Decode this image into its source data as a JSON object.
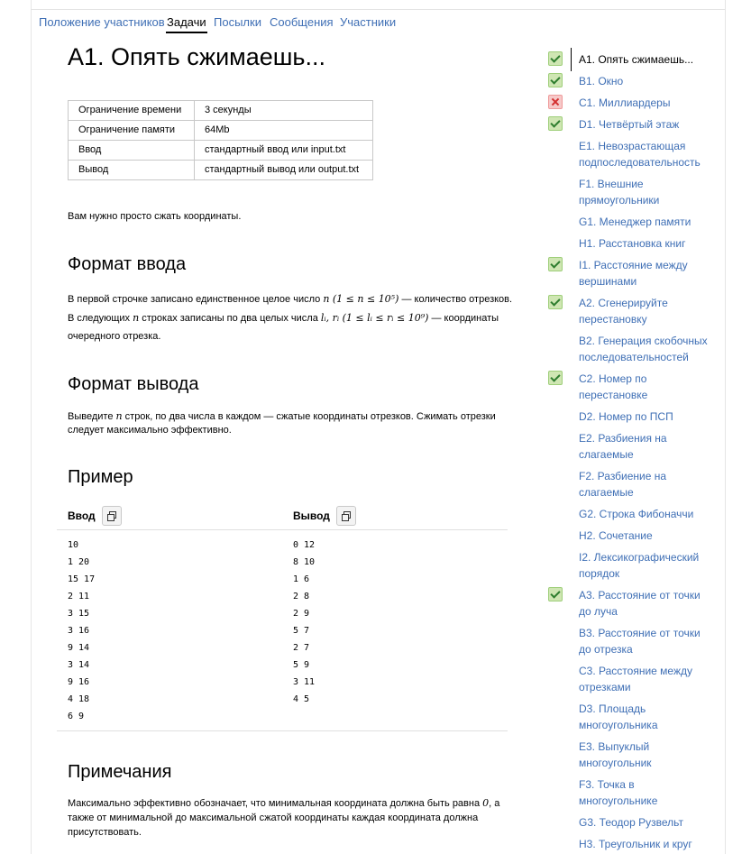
{
  "tabs": [
    "Положение участников",
    "Задачи",
    "Посылки",
    "Сообщения",
    "Участники"
  ],
  "problem": {
    "title": "А1. Опять сжимаешь...",
    "limits": [
      {
        "k": "Ограничение времени",
        "v": "3 секунды"
      },
      {
        "k": "Ограничение памяти",
        "v": "64Mb"
      },
      {
        "k": "Ввод",
        "v": "стандартный ввод или input.txt"
      },
      {
        "k": "Вывод",
        "v": "стандартный вывод или output.txt"
      }
    ],
    "statement": "Вам нужно просто сжать координаты.",
    "input_heading": "Формат ввода",
    "input_p1_a": "В первой строчке записано единственное целое число ",
    "input_p1_math": "n (1 ≤ n ≤ 10⁵)",
    "input_p1_b": " — количество отрезков.",
    "input_p2_a": "В следующих ",
    "input_p2_math1": "n",
    "input_p2_b": " строках записаны по два целых числа ",
    "input_p2_math2": "lᵢ, rᵢ (1 ≤ lᵢ ≤ rᵢ ≤ 10⁹)",
    "input_p2_c": " — координаты",
    "input_p3": "очередного отрезка.",
    "output_heading": "Формат вывода",
    "output_p1_a": "Выведите ",
    "output_p1_math": "n",
    "output_p1_b": " строк, по два числа в каждом — сжатые координаты отрезков. Сжимать отрезки",
    "output_p2": "следует максимально эффективно.",
    "example_heading": "Пример",
    "input_label": "Ввод",
    "output_label": "Вывод",
    "sample_input": [
      "10",
      "1 20",
      "15 17",
      "2 11",
      "3 15",
      "3 16",
      "9 14",
      "3 14",
      "9 16",
      "4 18",
      "6 9"
    ],
    "sample_output": [
      "0 12",
      "8 10",
      "1 6",
      "2 8",
      "2 9",
      "5 7",
      "2 7",
      "5 9",
      "3 11",
      "4 5"
    ],
    "notes_heading": "Примечания",
    "notes_p1_a": "Максимально эффективно обозначает, что минимальная координата должна быть равна ",
    "notes_p1_math": "0",
    "notes_p1_b": ", а",
    "notes_p2": "также от минимальной до максимальной сжатой координаты каждая координата должна",
    "notes_p3": "присутствовать."
  },
  "sidebar": [
    {
      "label": "А1. Опять сжимаешь...",
      "status": "ok",
      "active": true
    },
    {
      "label": "B1. Окно",
      "status": "ok"
    },
    {
      "label": "C1. Миллиардеры",
      "status": "fail"
    },
    {
      "label": "D1. Четвёртый этаж",
      "status": "ok"
    },
    {
      "label": "E1. Невозрастающая подпоследовательность",
      "status": "none"
    },
    {
      "label": "F1. Внешние прямоугольники",
      "status": "none"
    },
    {
      "label": "G1. Менеджер памяти",
      "status": "none"
    },
    {
      "label": "H1. Расстановка книг",
      "status": "none"
    },
    {
      "label": "I1. Расстояние между вершинами",
      "status": "ok"
    },
    {
      "label": "A2. Сгенерируйте перестановку",
      "status": "ok"
    },
    {
      "label": "B2. Генерация скобочных последовательностей",
      "status": "none"
    },
    {
      "label": "C2. Номер по перестановке",
      "status": "ok"
    },
    {
      "label": "D2. Номер по ПСП",
      "status": "none"
    },
    {
      "label": "E2. Разбиения на слагаемые",
      "status": "none"
    },
    {
      "label": "F2. Разбиение на слагаемые",
      "status": "none"
    },
    {
      "label": "G2. Строка Фибоначчи",
      "status": "none"
    },
    {
      "label": "H2. Сочетание",
      "status": "none"
    },
    {
      "label": "I2. Лексикографический порядок",
      "status": "none"
    },
    {
      "label": "A3. Расстояние от точки до луча",
      "status": "ok"
    },
    {
      "label": "B3. Расстояние от точки до отрезка",
      "status": "none"
    },
    {
      "label": "C3. Расстояние между отрезками",
      "status": "none"
    },
    {
      "label": "D3. Площадь многоугольника",
      "status": "none"
    },
    {
      "label": "E3. Выпуклый многоугольник",
      "status": "none"
    },
    {
      "label": "F3. Точка в многоугольнике",
      "status": "none"
    },
    {
      "label": "G3. Теодор Рузвельт",
      "status": "none"
    },
    {
      "label": "H3. Треугольник и круг",
      "status": "none"
    }
  ]
}
